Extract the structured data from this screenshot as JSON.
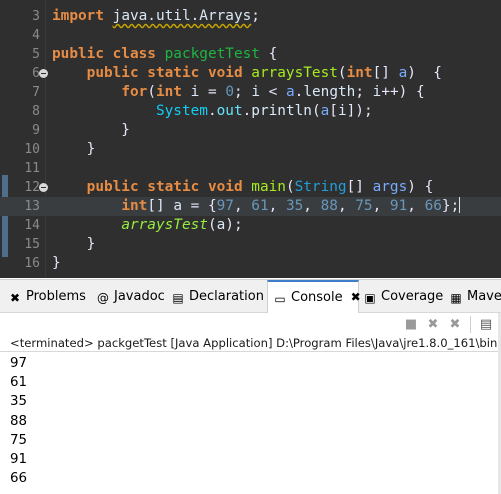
{
  "editor": {
    "lines": [
      {
        "num": "3",
        "tokens": [
          [
            "kw",
            "import "
          ],
          [
            "squiggle",
            "java.util.Arrays"
          ],
          [
            "punct",
            ";"
          ]
        ]
      },
      {
        "num": "4",
        "tokens": []
      },
      {
        "num": "5",
        "tokens": [
          [
            "kw",
            "public class "
          ],
          [
            "cls",
            "packgetTest"
          ],
          [
            "punct",
            " {"
          ]
        ]
      },
      {
        "num": "6",
        "fold": true,
        "tokens": [
          [
            "punct",
            "    "
          ],
          [
            "kw",
            "public static void "
          ],
          [
            "mth",
            "arraysTest"
          ],
          [
            "punct",
            "("
          ],
          [
            "kw",
            "int"
          ],
          [
            "punct",
            "[] "
          ],
          [
            "var",
            "a"
          ],
          [
            "punct",
            ")  {"
          ]
        ]
      },
      {
        "num": "7",
        "tokens": [
          [
            "punct",
            "        "
          ],
          [
            "kw",
            "for"
          ],
          [
            "punct",
            "("
          ],
          [
            "kw",
            "int "
          ],
          [
            "id",
            "i"
          ],
          [
            "punct",
            " = "
          ],
          [
            "num",
            "0"
          ],
          [
            "punct",
            "; "
          ],
          [
            "id",
            "i"
          ],
          [
            "punct",
            " < "
          ],
          [
            "var",
            "a"
          ],
          [
            "punct",
            "."
          ],
          [
            "id",
            "length"
          ],
          [
            "punct",
            "; "
          ],
          [
            "id",
            "i"
          ],
          [
            "punct",
            "++) {"
          ]
        ]
      },
      {
        "num": "8",
        "tokens": [
          [
            "punct",
            "            "
          ],
          [
            "sys",
            "System"
          ],
          [
            "punct",
            "."
          ],
          [
            "fld",
            "out"
          ],
          [
            "punct",
            "."
          ],
          [
            "id",
            "println"
          ],
          [
            "punct",
            "("
          ],
          [
            "var",
            "a"
          ],
          [
            "punct",
            "["
          ],
          [
            "id",
            "i"
          ],
          [
            "punct",
            "]);"
          ]
        ]
      },
      {
        "num": "9",
        "tokens": [
          [
            "punct",
            "        }"
          ]
        ]
      },
      {
        "num": "10",
        "tokens": [
          [
            "punct",
            "    }"
          ]
        ]
      },
      {
        "num": "11",
        "tokens": []
      },
      {
        "num": "12",
        "fold": true,
        "tokens": [
          [
            "punct",
            "    "
          ],
          [
            "kw",
            "public static void "
          ],
          [
            "mth",
            "main"
          ],
          [
            "punct",
            "("
          ],
          [
            "type",
            "String"
          ],
          [
            "punct",
            "[] "
          ],
          [
            "var",
            "args"
          ],
          [
            "punct",
            ") {"
          ]
        ]
      },
      {
        "num": "13",
        "current": true,
        "caret": true,
        "tokens": [
          [
            "punct",
            "        "
          ],
          [
            "kw",
            "int"
          ],
          [
            "punct",
            "[] "
          ],
          [
            "id",
            "a"
          ],
          [
            "punct",
            " = {"
          ],
          [
            "num",
            "97"
          ],
          [
            "punct",
            ", "
          ],
          [
            "num",
            "61"
          ],
          [
            "punct",
            ", "
          ],
          [
            "num",
            "35"
          ],
          [
            "punct",
            ", "
          ],
          [
            "num",
            "88"
          ],
          [
            "punct",
            ", "
          ],
          [
            "num",
            "75"
          ],
          [
            "punct",
            ", "
          ],
          [
            "num",
            "91"
          ],
          [
            "punct",
            ", "
          ],
          [
            "num",
            "66"
          ],
          [
            "punct",
            "};"
          ]
        ]
      },
      {
        "num": "14",
        "tokens": [
          [
            "punct",
            "        "
          ],
          [
            "static",
            "arraysTest"
          ],
          [
            "punct",
            "("
          ],
          [
            "id",
            "a"
          ],
          [
            "punct",
            ");"
          ]
        ]
      },
      {
        "num": "15",
        "tokens": [
          [
            "punct",
            "    }"
          ]
        ]
      },
      {
        "num": "16",
        "tokens": [
          [
            "punct",
            "}"
          ]
        ]
      }
    ]
  },
  "tabs": [
    {
      "label": "Problems",
      "icon": "problems-icon",
      "glyph": "✖"
    },
    {
      "label": "Javadoc",
      "icon": "javadoc-icon",
      "glyph": "@"
    },
    {
      "label": "Declaration",
      "icon": "declaration-icon",
      "glyph": "▤"
    },
    {
      "label": "Console",
      "icon": "console-icon",
      "glyph": "▭",
      "active": true,
      "close": "✖"
    },
    {
      "label": "Coverage",
      "icon": "coverage-icon",
      "glyph": "▣"
    },
    {
      "label": "Mave",
      "icon": "maven-icon",
      "glyph": "▦"
    }
  ],
  "toolbar": {
    "buttons": [
      {
        "name": "terminate-icon",
        "glyph": "■"
      },
      {
        "name": "remove-launch-icon",
        "glyph": "✖"
      },
      {
        "name": "remove-all-icon",
        "glyph": "✖"
      }
    ],
    "clear_glyph": "▤"
  },
  "console": {
    "header": "<terminated> packgetTest [Java Application] D:\\Program Files\\Java\\jre1.8.0_161\\bin",
    "output": [
      "97",
      "61",
      "35",
      "88",
      "75",
      "91",
      "66"
    ]
  },
  "colors": {
    "editor_bg": "#2f2f2f",
    "keyword": "#e78c45",
    "number": "#6897bb",
    "active_tab_accent": "#3d7dca"
  }
}
